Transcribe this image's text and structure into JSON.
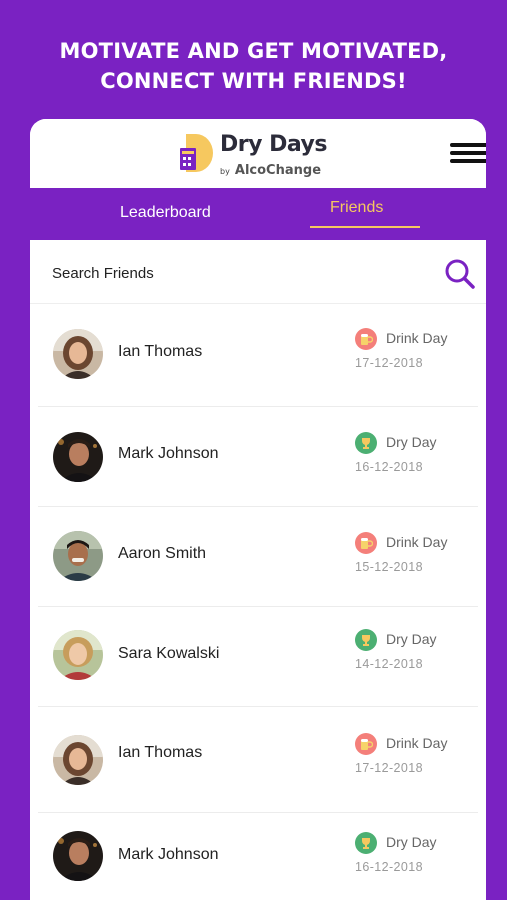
{
  "headline": {
    "line1": "MOTIVATE AND GET MOTIVATED,",
    "line2": "CONNECT WITH FRIENDS!"
  },
  "logo": {
    "title": "Dry Days",
    "by": "by",
    "brand": "AlcoChange"
  },
  "tabs": {
    "leaderboard": "Leaderboard",
    "friends": "Friends",
    "active": "friends"
  },
  "search": {
    "placeholder": "Search Friends"
  },
  "colors": {
    "brand_purple": "#7a22c2",
    "accent_yellow": "#f6c85f",
    "drink_badge": "#f47f7a",
    "dry_badge": "#4caf72"
  },
  "friends": [
    {
      "name": "Ian Thomas",
      "status": "Drink Day",
      "status_icon": "beer-mug-icon",
      "date": "17-12-2018"
    },
    {
      "name": "Mark Johnson",
      "status": "Dry Day",
      "status_icon": "trophy-icon",
      "date": "16-12-2018"
    },
    {
      "name": "Aaron Smith",
      "status": "Drink Day",
      "status_icon": "beer-mug-icon",
      "date": "15-12-2018"
    },
    {
      "name": "Sara Kowalski",
      "status": "Dry Day",
      "status_icon": "trophy-icon",
      "date": "14-12-2018"
    },
    {
      "name": "Ian Thomas",
      "status": "Drink Day",
      "status_icon": "beer-mug-icon",
      "date": "17-12-2018"
    },
    {
      "name": "Mark Johnson",
      "status": "Dry Day",
      "status_icon": "trophy-icon",
      "date": "16-12-2018"
    }
  ]
}
